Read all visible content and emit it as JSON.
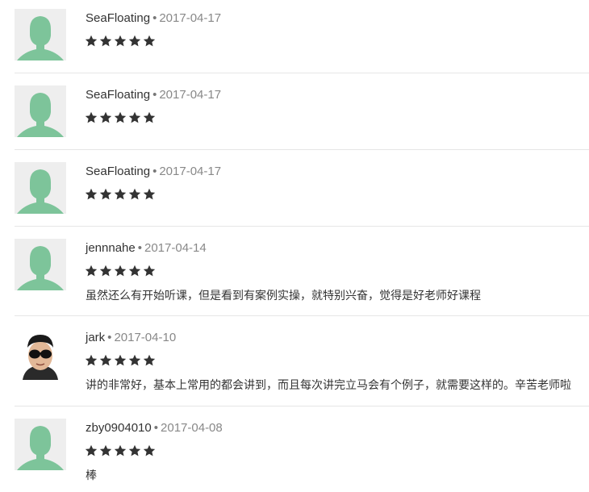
{
  "reviews": [
    {
      "user": "SeaFloating",
      "separator": "•",
      "date": "2017-04-17",
      "rating": 5,
      "max_rating": 5,
      "comment": "",
      "avatar": "default-person-icon"
    },
    {
      "user": "SeaFloating",
      "separator": "•",
      "date": "2017-04-17",
      "rating": 5,
      "max_rating": 5,
      "comment": "",
      "avatar": "default-person-icon"
    },
    {
      "user": "SeaFloating",
      "separator": "•",
      "date": "2017-04-17",
      "rating": 5,
      "max_rating": 5,
      "comment": "",
      "avatar": "default-person-icon"
    },
    {
      "user": "jennnahe",
      "separator": "•",
      "date": "2017-04-14",
      "rating": 5,
      "max_rating": 5,
      "comment": "虽然还么有开始听课，但是看到有案例实操，就特别兴奋，觉得是好老师好课程",
      "avatar": "default-person-icon"
    },
    {
      "user": "jark",
      "separator": "•",
      "date": "2017-04-10",
      "rating": 5,
      "max_rating": 5,
      "comment": "讲的非常好，基本上常用的都会讲到，而且每次讲完立马会有个例子，就需要这样的。辛苦老师啦",
      "avatar": "user-photo-sunglasses"
    },
    {
      "user": "zby0904010",
      "separator": "•",
      "date": "2017-04-08",
      "rating": 5,
      "max_rating": 5,
      "comment": "棒",
      "avatar": "default-person-icon"
    }
  ],
  "colors": {
    "avatar_bg": "#eeeeee",
    "avatar_figure": "#7dc49a",
    "star": "#333333",
    "divider": "#e6e6e6",
    "name": "#333333",
    "date": "#888888"
  }
}
